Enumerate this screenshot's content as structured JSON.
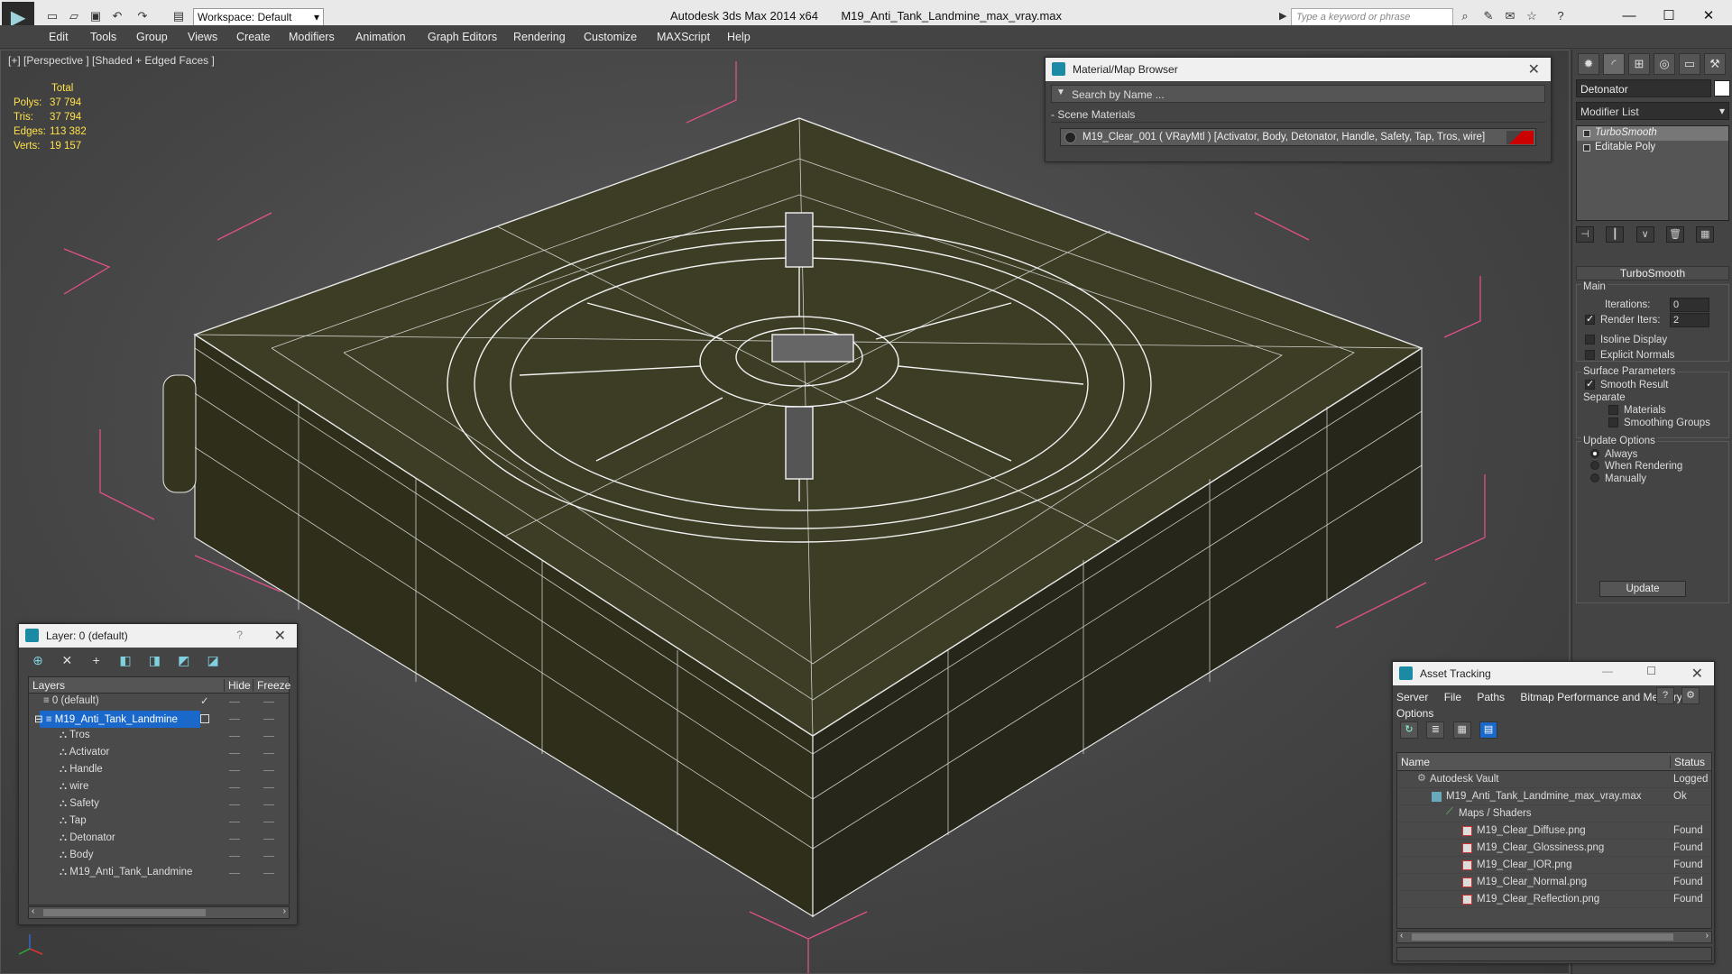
{
  "titlebar": {
    "workspace": "Workspace: Default",
    "app": "Autodesk 3ds Max  2014 x64",
    "file": "M19_Anti_Tank_Landmine_max_vray.max",
    "search_placeholder": "Type a keyword or phrase"
  },
  "menu": [
    "Edit",
    "Tools",
    "Group",
    "Views",
    "Create",
    "Modifiers",
    "Animation",
    "Graph Editors",
    "Rendering",
    "Customize",
    "MAXScript",
    "Help"
  ],
  "viewport": {
    "label": "[+] [Perspective ] [Shaded + Edged Faces ]",
    "stats": {
      "header": "Total",
      "rows": [
        {
          "label": "Polys:",
          "value": "37 794"
        },
        {
          "label": "Tris:",
          "value": "37 794"
        },
        {
          "label": "Edges:",
          "value": "113 382"
        },
        {
          "label": "Verts:",
          "value": "19 157"
        }
      ]
    },
    "colors": {
      "mesh": "#3a3a22",
      "wire": "#e8e8e8",
      "bbox": "#e0508a"
    }
  },
  "material_browser": {
    "title": "Material/Map Browser",
    "search": "Search by Name ...",
    "section": "- Scene Materials",
    "material": "M19_Clear_001  ( VRayMtl )  [Activator, Body, Detonator, Handle, Safety, Tap, Tros, wire]"
  },
  "command_panel": {
    "object_name": "Detonator",
    "modifier_list": "Modifier List",
    "stack": [
      "TurboSmooth",
      "Editable Poly"
    ],
    "rollout": "TurboSmooth",
    "main_label": "Main",
    "iterations_label": "Iterations:",
    "iterations_value": "0",
    "render_iters_label": "Render Iters:",
    "render_iters_value": "2",
    "isoline": "Isoline Display",
    "explicit_normals": "Explicit Normals",
    "surface_params": "Surface Parameters",
    "smooth_result": "Smooth Result",
    "separate": "Separate",
    "materials": "Materials",
    "smoothing_groups": "Smoothing Groups",
    "update_options": "Update Options",
    "always": "Always",
    "when_rendering": "When Rendering",
    "manually": "Manually",
    "update_button": "Update"
  },
  "layer_dialog": {
    "title": "Layer: 0 (default)",
    "help": "?",
    "col_layers": "Layers",
    "col_hide": "Hide",
    "col_freeze": "Freeze",
    "layers": [
      "0 (default)",
      "M19_Anti_Tank_Landmine"
    ],
    "objects": [
      "Tros",
      "Activator",
      "Handle",
      "wire",
      "Safety",
      "Tap",
      "Detonator",
      "Body",
      "M19_Anti_Tank_Landmine"
    ]
  },
  "asset_tracking": {
    "title": "Asset Tracking",
    "menu": [
      "Server",
      "File",
      "Paths",
      "Bitmap Performance and Memory",
      "Options"
    ],
    "col_name": "Name",
    "col_status": "Status",
    "rows": [
      {
        "name": "Autodesk Vault",
        "status": "Logged Out"
      },
      {
        "name": "M19_Anti_Tank_Landmine_max_vray.max",
        "status": "Ok"
      },
      {
        "name": "Maps / Shaders",
        "status": ""
      },
      {
        "name": "M19_Clear_Diffuse.png",
        "status": "Found"
      },
      {
        "name": "M19_Clear_Glossiness.png",
        "status": "Found"
      },
      {
        "name": "M19_Clear_IOR.png",
        "status": "Found"
      },
      {
        "name": "M19_Clear_Normal.png",
        "status": "Found"
      },
      {
        "name": "M19_Clear_Reflection.png",
        "status": "Found"
      }
    ]
  }
}
